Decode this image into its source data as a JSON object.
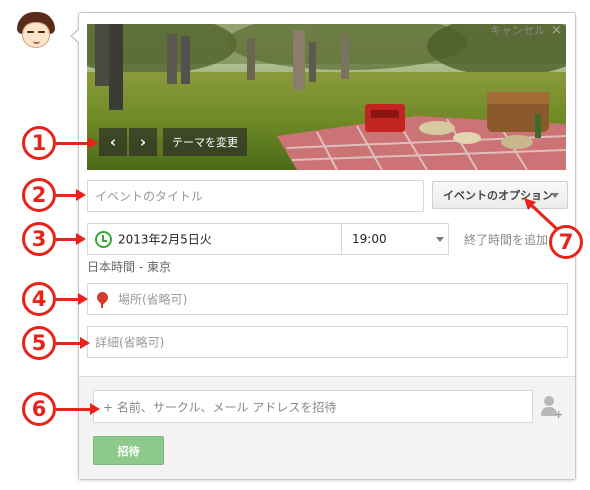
{
  "dialog": {
    "cancel_label": "キャンセル",
    "close_glyph": "×"
  },
  "theme": {
    "prev_glyph": "‹",
    "next_glyph": "›",
    "change_label": "テーマを変更"
  },
  "form": {
    "title_placeholder": "イベントのタイトル",
    "options_label": "イベントのオプション",
    "date_value": "2013年2月5日火",
    "time_value": "19:00",
    "end_time_link": "終了時間を追加",
    "timezone": "日本時間 - 東京",
    "place_placeholder": "場所(省略可)",
    "detail_placeholder": "詳細(省略可)"
  },
  "invite": {
    "placeholder": "+ 名前、サークル、メール アドレスを招待",
    "button_label": "招待"
  },
  "annotations": [
    "1",
    "2",
    "3",
    "4",
    "5",
    "6",
    "7"
  ],
  "colors": {
    "annotation_red": "#e8231a",
    "invite_button_green": "#8dc98a",
    "clock_green": "#3aa63a",
    "pin_red": "#d23a2c"
  },
  "icons": [
    "clock-icon",
    "map-pin-icon",
    "add-person-icon",
    "chevron-down-icon",
    "close-icon"
  ]
}
